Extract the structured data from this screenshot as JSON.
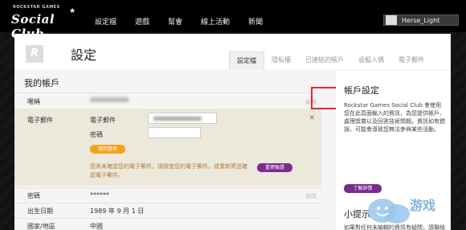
{
  "logo": {
    "top": "ROCKSTAR GAMES",
    "main": "Social Club"
  },
  "nav": [
    "設定檔",
    "遊戲",
    "幫會",
    "線上活動",
    "新聞"
  ],
  "user": {
    "name": "Herse_Light"
  },
  "page": {
    "title": "設定"
  },
  "tabs": [
    "設定檔",
    "隱私權",
    "已連結的帳戶",
    "虛擬人偶",
    "電子郵件"
  ],
  "account": {
    "title": "我的帳戶",
    "nickname_label": "暱稱",
    "nickname_action": "編輯",
    "email": {
      "label": "電子郵件",
      "field_email": "電子郵件",
      "field_password": "密碼",
      "save": "儲存變更",
      "warning": "您尚未確認您的電子郵件，請檢查您的電子郵件，或重新寄送確認電子郵件。",
      "resend": "重寄驗證"
    },
    "password_label": "密碼",
    "password_value": "******",
    "password_action": "修改",
    "birthday_label": "出生日期",
    "birthday_value": "1989 年 9 月 1 日",
    "country_label": "國家/地區",
    "country_value": "中國"
  },
  "sidebar": {
    "settings_title": "帳戶設定",
    "settings_text": "Rockstar Games Social Club 會使用您在此頁面輸入的資訊，為您提供帳戶、處理獎賞以及回答技術問題。資訊如有錯誤，可能會導致您無法參與某些活動。",
    "more": "了解詳情",
    "tips_title": "小提示",
    "tips_text": "如果對任何未編輯的資訊有疑問，請聯絡支援團隊。"
  },
  "watermark": "游戏"
}
